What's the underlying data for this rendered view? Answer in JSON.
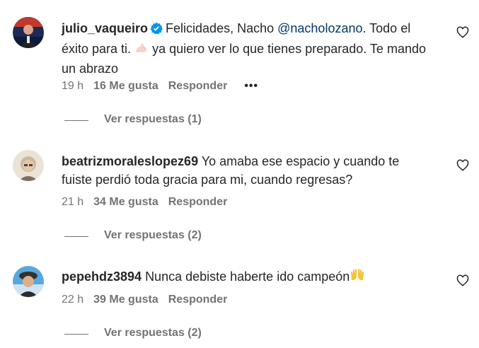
{
  "comments": [
    {
      "username": "julio_vaqueiro",
      "verified": true,
      "text_before": "Felicidades, Nacho ",
      "mention": "@nacholozano",
      "text_after": ". Todo el éxito para ti. ",
      "emoji": "flexed-biceps",
      "text_end": " ya quiero ver lo que tienes preparado. Te mando un abrazo",
      "time": "19 h",
      "likes": "16 Me gusta",
      "reply": "Responder",
      "more": "•••",
      "view_replies": "Ver respuestas (1)"
    },
    {
      "username": "beatrizmoraleslopez69",
      "text": "Yo amaba ese espacio y cuando te fuiste perdió toda gracia para mi, cuando regresas?",
      "time": "21 h",
      "likes": "34 Me gusta",
      "reply": "Responder",
      "view_replies": "Ver respuestas (2)"
    },
    {
      "username": "pepehdz3894",
      "text": "Nunca debiste haberte ido campeón",
      "emoji": "raising-hands",
      "time": "22 h",
      "likes": "39 Me gusta",
      "reply": "Responder",
      "view_replies": "Ver respuestas (2)"
    }
  ],
  "colors": {
    "text": "#262626",
    "secondary": "#737373",
    "mention": "#00376b",
    "verified": "#0095f6"
  }
}
